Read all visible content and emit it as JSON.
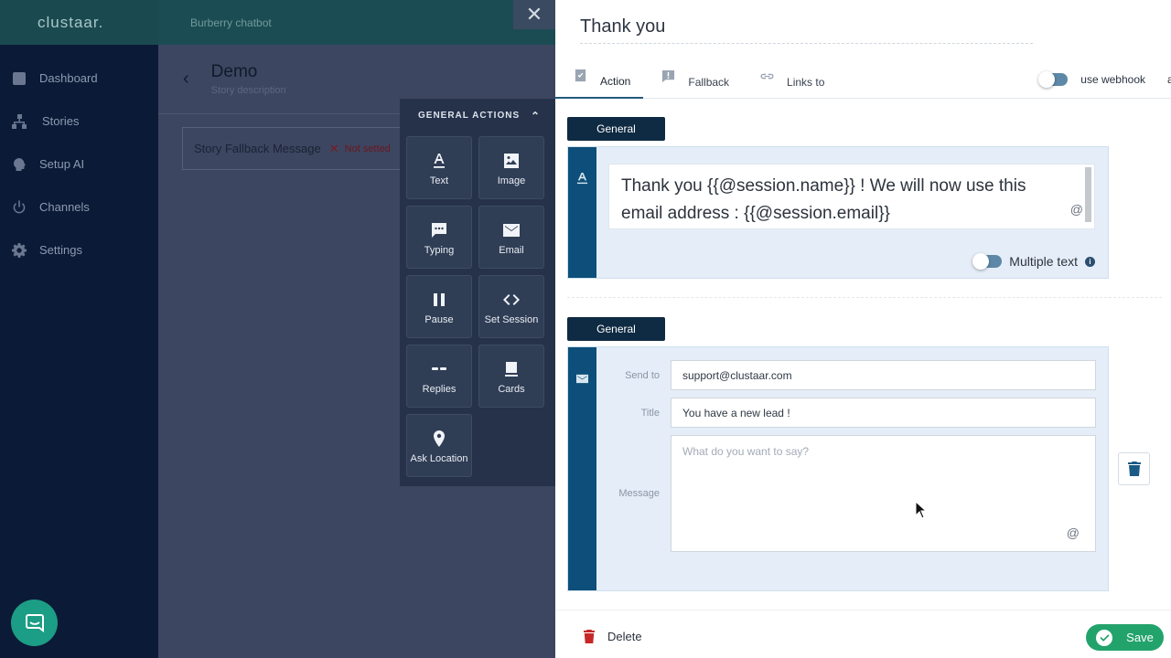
{
  "brand": {
    "logo": "clustaar."
  },
  "sidebar": {
    "items": [
      {
        "label": "Dashboard",
        "icon": "dashboard-icon"
      },
      {
        "label": "Stories",
        "icon": "stories-icon"
      },
      {
        "label": "Setup AI",
        "icon": "brain-icon"
      },
      {
        "label": "Channels",
        "icon": "power-icon"
      },
      {
        "label": "Settings",
        "icon": "gear-icon"
      }
    ]
  },
  "topbar": {
    "bot_name": "Burberry chatbot",
    "close": "✕"
  },
  "story": {
    "title": "Demo",
    "description": "Story description",
    "fallback_label": "Story Fallback Message",
    "fallback_status": "Not setted"
  },
  "general_actions": {
    "title": "GENERAL ACTIONS",
    "tiles": [
      {
        "label": "Text",
        "icon": "text-icon"
      },
      {
        "label": "Image",
        "icon": "image-icon"
      },
      {
        "label": "Typing",
        "icon": "typing-icon"
      },
      {
        "label": "Email",
        "icon": "email-icon"
      },
      {
        "label": "Pause",
        "icon": "pause-icon"
      },
      {
        "label": "Set Session",
        "icon": "code-icon"
      },
      {
        "label": "Replies",
        "icon": "replies-icon"
      },
      {
        "label": "Cards",
        "icon": "cards-icon"
      },
      {
        "label": "Ask Location",
        "icon": "location-icon"
      }
    ]
  },
  "editor": {
    "title": "Thank you",
    "tabs": [
      {
        "label": "Action",
        "active": true
      },
      {
        "label": "Fallback",
        "active": false
      },
      {
        "label": "Links to",
        "active": false
      }
    ],
    "webhook_label": "use webhook",
    "cut_label": "a",
    "text_block": {
      "section": "General",
      "message": "Thank you {{@session.name}} ! We will now use this email address : {{@session.email}}",
      "at": "@",
      "multiple_text_label": "Multiple text",
      "info": "i"
    },
    "email_block": {
      "section": "General",
      "send_to_label": "Send to",
      "send_to_value": "support@clustaar.com",
      "title_label": "Title",
      "title_value": "You have a new lead !",
      "message_label": "Message",
      "message_placeholder": "What do you want to say?",
      "at": "@"
    },
    "footer": {
      "delete_label": "Delete",
      "save_label": "Save"
    }
  },
  "colors": {
    "accent": "#0d4f7a",
    "save": "#23a36c",
    "delete": "#c62828",
    "sidebar": "#0b1a36"
  }
}
